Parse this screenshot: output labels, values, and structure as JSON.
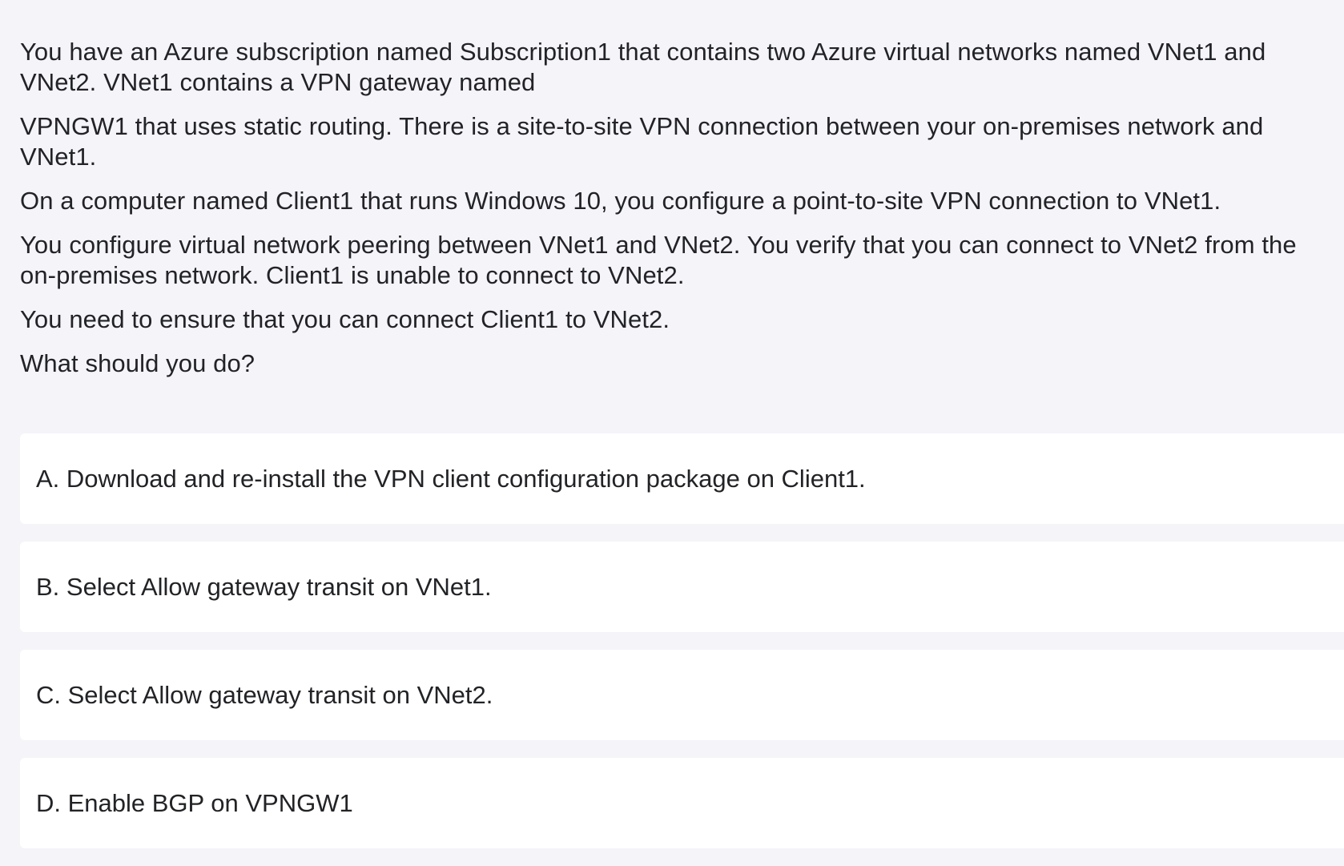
{
  "question": {
    "paragraphs": [
      "You have an Azure subscription named Subscription1 that contains two Azure virtual networks named VNet1 and VNet2. VNet1 contains a VPN gateway named",
      "VPNGW1 that uses static routing. There is a site-to-site VPN connection between your on-premises network and VNet1.",
      "On a computer named Client1 that runs Windows 10, you configure a point-to-site VPN connection to VNet1.",
      "You configure virtual network peering between VNet1 and VNet2. You verify that you can connect to VNet2 from the on-premises network. Client1 is unable to connect to VNet2.",
      "You need to ensure that you can connect Client1 to VNet2.",
      "What should you do?"
    ]
  },
  "options": [
    {
      "label": "A. Download and re-install the VPN client configuration package on Client1."
    },
    {
      "label": "B. Select Allow gateway transit on VNet1."
    },
    {
      "label": "C. Select Allow gateway transit on VNet2."
    },
    {
      "label": "D. Enable BGP on VPNGW1"
    }
  ],
  "colors": {
    "background": "#f4f4f9",
    "card": "#ffffff",
    "text": "#222326"
  }
}
